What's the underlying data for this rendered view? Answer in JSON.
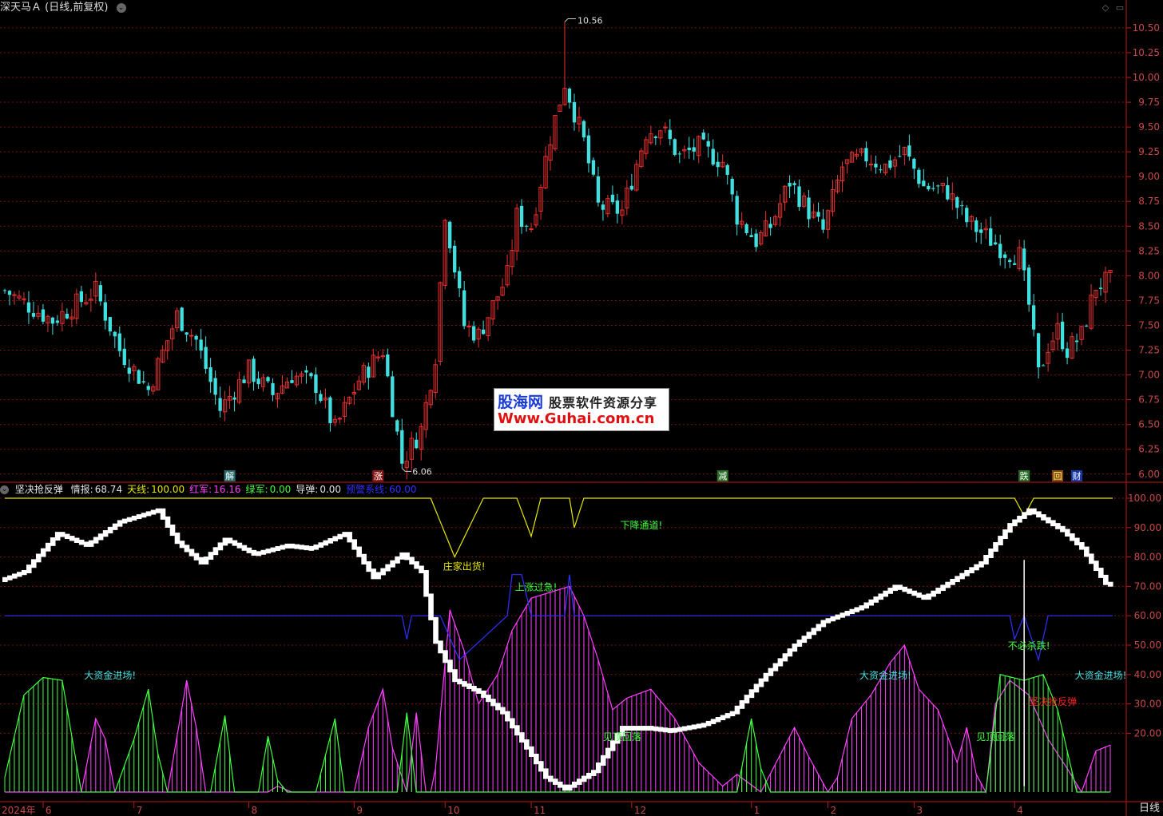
{
  "window": {
    "title": "深天马Ａ",
    "subtitle": "(日线,前复权)",
    "period_label": "日线"
  },
  "watermark": {
    "logo": "股海网",
    "tagline": "股票软件资源分享",
    "url": "Www.Guhai.com.cn"
  },
  "indicator_header": {
    "name": "坚决抢反弹",
    "items": [
      {
        "label": "情报:",
        "value": "68.74",
        "color": "#e0e0e0"
      },
      {
        "label": "天线:",
        "value": "100.00",
        "color": "#e6e600"
      },
      {
        "label": "红军:",
        "value": "16.16",
        "color": "#ff40ff"
      },
      {
        "label": "绿军:",
        "value": "0.00",
        "color": "#40ff40"
      },
      {
        "label": "导弹:",
        "value": "0.00",
        "color": "#e0e0e0"
      },
      {
        "label": "预警系线:",
        "value": "60.00",
        "color": "#3030ff"
      }
    ]
  },
  "colors": {
    "up": "#e83030",
    "down": "#40e0e0",
    "grid": "#7a1010",
    "axis": "#c01818",
    "axis_text": "#c84848",
    "tianxian": "#e6e600",
    "red_army": "#ff40ff",
    "green_army": "#40ff40",
    "warning": "#3030ff"
  },
  "chart_data": [
    {
      "type": "candlestick",
      "title": "深天马Ａ (日线,前复权)",
      "ylim": [
        5.95,
        10.62
      ],
      "yticks": [
        "10.50",
        "10.25",
        "10.00",
        "9.75",
        "9.50",
        "9.25",
        "9.00",
        "8.75",
        "8.50",
        "8.25",
        "8.00",
        "7.75",
        "7.50",
        "7.25",
        "7.00",
        "6.75",
        "6.50",
        "6.25",
        "6.00"
      ],
      "high_label": "10.56",
      "low_label": "6.06",
      "high_index": 117,
      "low_index": 83,
      "markers": [
        {
          "index": 47,
          "text": "解",
          "color": "#ffffff",
          "bg": "#2a6f6f"
        },
        {
          "index": 78,
          "text": "涨",
          "color": "#ffffff",
          "bg": "#8a1818"
        },
        {
          "index": 150,
          "text": "减",
          "color": "#ffffff",
          "bg": "#2a6f2a"
        },
        {
          "index": 213,
          "text": "跌",
          "color": "#ffffff",
          "bg": "#2a6f2a"
        },
        {
          "index": 220,
          "text": "回",
          "color": "#ffff60",
          "bg": "#8a4818"
        },
        {
          "index": 224,
          "text": "财",
          "color": "#ffffff",
          "bg": "#1838a8"
        }
      ],
      "key_points": [
        [
          0,
          7.85
        ],
        [
          10,
          7.55
        ],
        [
          19,
          7.85
        ],
        [
          24,
          7.25
        ],
        [
          30,
          6.85
        ],
        [
          36,
          7.6
        ],
        [
          40,
          7.35
        ],
        [
          45,
          6.65
        ],
        [
          51,
          7.05
        ],
        [
          56,
          6.8
        ],
        [
          60,
          7.0
        ],
        [
          65,
          6.9
        ],
        [
          69,
          6.45
        ],
        [
          74,
          6.95
        ],
        [
          79,
          7.25
        ],
        [
          83,
          6.12
        ],
        [
          87,
          6.45
        ],
        [
          90,
          7.2
        ],
        [
          92,
          8.65
        ],
        [
          96,
          7.5
        ],
        [
          99,
          7.4
        ],
        [
          105,
          8.0
        ],
        [
          107,
          8.6
        ],
        [
          110,
          8.5
        ],
        [
          114,
          9.4
        ],
        [
          117,
          9.95
        ],
        [
          121,
          9.35
        ],
        [
          124,
          8.7
        ],
        [
          129,
          8.65
        ],
        [
          134,
          9.45
        ],
        [
          137,
          9.5
        ],
        [
          141,
          9.2
        ],
        [
          145,
          9.3
        ],
        [
          150,
          9.15
        ],
        [
          153,
          8.6
        ],
        [
          157,
          8.35
        ],
        [
          160,
          8.5
        ],
        [
          164,
          8.95
        ],
        [
          168,
          8.65
        ],
        [
          171,
          8.45
        ],
        [
          175,
          9.1
        ],
        [
          180,
          9.2
        ],
        [
          184,
          9.1
        ],
        [
          188,
          9.25
        ],
        [
          192,
          8.9
        ],
        [
          197,
          8.85
        ],
        [
          201,
          8.55
        ],
        [
          205,
          8.4
        ],
        [
          209,
          8.25
        ],
        [
          212,
          8.2
        ],
        [
          214,
          7.7
        ],
        [
          216,
          7.0
        ],
        [
          218,
          7.3
        ],
        [
          220,
          7.45
        ],
        [
          222,
          7.25
        ],
        [
          225,
          7.4
        ],
        [
          228,
          7.9
        ],
        [
          231,
          7.95
        ]
      ],
      "total_bars": 232
    },
    {
      "type": "indicator",
      "title": "坚决抢反弹",
      "ylim": [
        -1,
        104
      ],
      "yticks": [
        "100.00",
        "90.00",
        "80.00",
        "70.00",
        "60.00",
        "50.00",
        "40.00",
        "30.00",
        "20.00"
      ],
      "series": [
        {
          "name": "情报",
          "key_points": [
            [
              0,
              72
            ],
            [
              5,
              75
            ],
            [
              12,
              88
            ],
            [
              18,
              84
            ],
            [
              25,
              92
            ],
            [
              33,
              96
            ],
            [
              37,
              85
            ],
            [
              42,
              78
            ],
            [
              47,
              86
            ],
            [
              53,
              81
            ],
            [
              60,
              84
            ],
            [
              65,
              83
            ],
            [
              72,
              88
            ],
            [
              78,
              73
            ],
            [
              84,
              81
            ],
            [
              88,
              75
            ],
            [
              91,
              51
            ],
            [
              95,
              38
            ],
            [
              100,
              34
            ],
            [
              105,
              27
            ],
            [
              110,
              15
            ],
            [
              114,
              5
            ],
            [
              118,
              1
            ],
            [
              124,
              7
            ],
            [
              130,
              22
            ],
            [
              135,
              22
            ],
            [
              140,
              21
            ],
            [
              147,
              23
            ],
            [
              153,
              27
            ],
            [
              160,
              40
            ],
            [
              166,
              50
            ],
            [
              172,
              58
            ],
            [
              180,
              63
            ],
            [
              187,
              70
            ],
            [
              193,
              66
            ],
            [
              199,
              72
            ],
            [
              205,
              78
            ],
            [
              211,
              91
            ],
            [
              215,
              96
            ],
            [
              222,
              89
            ],
            [
              226,
              83
            ],
            [
              231,
              71
            ]
          ]
        },
        {
          "name": "天线",
          "key_points": [
            [
              0,
              100
            ],
            [
              89,
              100
            ],
            [
              94,
              80
            ],
            [
              100,
              100
            ],
            [
              107,
              100
            ],
            [
              110,
              87
            ],
            [
              112,
              100
            ],
            [
              118,
              100
            ],
            [
              119,
              90
            ],
            [
              121,
              100
            ],
            [
              211,
              100
            ],
            [
              213,
              94
            ],
            [
              215,
              100
            ],
            [
              229,
              100
            ]
          ]
        },
        {
          "name": "红军",
          "key_points": [
            [
              0,
              0
            ],
            [
              16,
              0
            ],
            [
              19,
              25
            ],
            [
              21,
              18
            ],
            [
              23,
              0
            ],
            [
              34,
              0
            ],
            [
              38,
              38
            ],
            [
              40,
              22
            ],
            [
              42,
              0
            ],
            [
              55,
              0
            ],
            [
              57,
              2
            ],
            [
              60,
              0
            ],
            [
              73,
              0
            ],
            [
              76,
              22
            ],
            [
              79,
              35
            ],
            [
              81,
              15
            ],
            [
              84,
              0
            ],
            [
              86,
              27
            ],
            [
              88,
              0
            ],
            [
              89,
              0
            ],
            [
              90,
              8
            ],
            [
              93,
              62
            ],
            [
              96,
              48
            ],
            [
              99,
              30
            ],
            [
              103,
              40
            ],
            [
              106,
              55
            ],
            [
              110,
              66
            ],
            [
              114,
              68
            ],
            [
              118,
              70
            ],
            [
              121,
              60
            ],
            [
              124,
              45
            ],
            [
              127,
              28
            ],
            [
              130,
              32
            ],
            [
              135,
              35
            ],
            [
              140,
              25
            ],
            [
              145,
              10
            ],
            [
              150,
              2
            ],
            [
              153,
              6
            ],
            [
              158,
              0
            ],
            [
              165,
              22
            ],
            [
              168,
              12
            ],
            [
              172,
              0
            ],
            [
              174,
              5
            ],
            [
              177,
              25
            ],
            [
              181,
              33
            ],
            [
              185,
              44
            ],
            [
              188,
              50
            ],
            [
              191,
              35
            ],
            [
              195,
              28
            ],
            [
              199,
              10
            ],
            [
              201,
              22
            ],
            [
              203,
              6
            ],
            [
              205,
              0
            ],
            [
              207,
              30
            ],
            [
              210,
              38
            ],
            [
              214,
              33
            ],
            [
              218,
              18
            ],
            [
              222,
              8
            ],
            [
              225,
              0
            ],
            [
              228,
              14
            ],
            [
              231,
              16
            ]
          ]
        },
        {
          "name": "绿军",
          "key_points": [
            [
              0,
              5
            ],
            [
              4,
              33
            ],
            [
              8,
              39
            ],
            [
              12,
              38
            ],
            [
              16,
              0
            ],
            [
              23,
              0
            ],
            [
              27,
              18
            ],
            [
              30,
              35
            ],
            [
              32,
              13
            ],
            [
              34,
              0
            ],
            [
              43,
              0
            ],
            [
              46,
              26
            ],
            [
              48,
              0
            ],
            [
              53,
              0
            ],
            [
              55,
              19
            ],
            [
              57,
              4
            ],
            [
              59,
              0
            ],
            [
              65,
              0
            ],
            [
              69,
              25
            ],
            [
              71,
              0
            ],
            [
              82,
              0
            ],
            [
              84,
              27
            ],
            [
              86,
              0
            ],
            [
              153,
              0
            ],
            [
              156,
              25
            ],
            [
              158,
              8
            ],
            [
              160,
              0
            ],
            [
              205,
              0
            ],
            [
              208,
              40
            ],
            [
              213,
              38
            ],
            [
              217,
              40
            ],
            [
              220,
              28
            ],
            [
              224,
              0
            ],
            [
              231,
              0
            ]
          ]
        },
        {
          "name": "预警系线",
          "key_points": [
            [
              0,
              60
            ],
            [
              83,
              60
            ],
            [
              84,
              52
            ],
            [
              85,
              60
            ],
            [
              91,
              60
            ],
            [
              95,
              45
            ],
            [
              105,
              60
            ],
            [
              106,
              74
            ],
            [
              108,
              74
            ],
            [
              110,
              60
            ],
            [
              117,
              60
            ],
            [
              118,
              74
            ],
            [
              119,
              60
            ],
            [
              210,
              60
            ],
            [
              211,
              52
            ],
            [
              213,
              60
            ],
            [
              216,
              45
            ],
            [
              218,
              60
            ],
            [
              231,
              60
            ]
          ]
        }
      ],
      "annotations": [
        {
          "text": "大资金进场!",
          "index": 22,
          "y": 40,
          "color": "#40e0e0"
        },
        {
          "text": "庄家出货!",
          "index": 96,
          "y": 77,
          "color": "#e6e600"
        },
        {
          "text": "上涨过急!",
          "index": 111,
          "y": 70,
          "color": "#40ff40"
        },
        {
          "text": "下降通道!",
          "index": 133,
          "y": 91,
          "color": "#40ff40"
        },
        {
          "text": "见顶回落",
          "index": 129,
          "y": 19,
          "color": "#40ff40"
        },
        {
          "text": "大资金进场!",
          "index": 184,
          "y": 40,
          "color": "#40e0e0"
        },
        {
          "text": "见顶回落",
          "index": 207,
          "y": 19,
          "color": "#40ff40"
        },
        {
          "text": "不必杀跌!",
          "index": 214,
          "y": 50,
          "color": "#40ff40"
        },
        {
          "text": "坚决抢反弹",
          "index": 219,
          "y": 31,
          "color": "#ff2020"
        },
        {
          "text": "大资金进场!",
          "index": 229,
          "y": 40,
          "color": "#40e0e0"
        }
      ]
    },
    {
      "type": "time_axis",
      "labels": [
        {
          "text": "2024年",
          "index": 0
        },
        {
          "text": "6",
          "index": 8
        },
        {
          "text": "7",
          "index": 27
        },
        {
          "text": "8",
          "index": 51
        },
        {
          "text": "9",
          "index": 73
        },
        {
          "text": "10",
          "index": 92
        },
        {
          "text": "11",
          "index": 110
        },
        {
          "text": "12",
          "index": 131
        },
        {
          "text": "1",
          "index": 156
        },
        {
          "text": "2",
          "index": 172
        },
        {
          "text": "3",
          "index": 190
        },
        {
          "text": "4",
          "index": 211
        }
      ]
    }
  ]
}
